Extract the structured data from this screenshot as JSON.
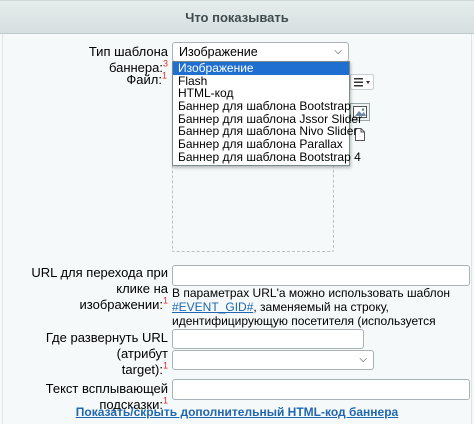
{
  "header": {
    "title": "Что показывать"
  },
  "banner_type": {
    "label": "Тип шаблона баннера:",
    "required_mark": "3",
    "selected": "Изображение",
    "options": [
      "Изображение",
      "Flash",
      "HTML-код",
      "Баннер для шаблона Bootstrap",
      "Баннер для шаблона Jssor Slider",
      "Баннер для шаблона Nivo Slider",
      "Баннер для шаблона Parallax",
      "Баннер для шаблона Bootstrap 4"
    ]
  },
  "file": {
    "label": "Файл:",
    "required_mark": "1"
  },
  "url": {
    "label_line1": "URL для перехода при клике на",
    "label_line2": "изображении:",
    "required_mark": "1",
    "value": "",
    "hint_pre": "В параметрах URL'а можно использовать шаблон",
    "hint_link": "#EVENT_GID#",
    "hint_post": ", заменяемый на строку, идентифицирующую посетителя (используется модулем статистики)"
  },
  "target": {
    "label_line1": "Где развернуть URL (атрибут",
    "label_line2": "target):",
    "required_mark": "1",
    "value": "",
    "select_value": ""
  },
  "tooltip": {
    "label": "Текст всплывающей подсказки:",
    "required_mark": "1",
    "value": ""
  },
  "footer": {
    "toggle_html_link": "Показать/скрыть дополнительный HTML-код баннера"
  },
  "colors": {
    "accent": "#2067b0",
    "selected_bg": "#1f6fd1",
    "required": "#e02c2c"
  }
}
